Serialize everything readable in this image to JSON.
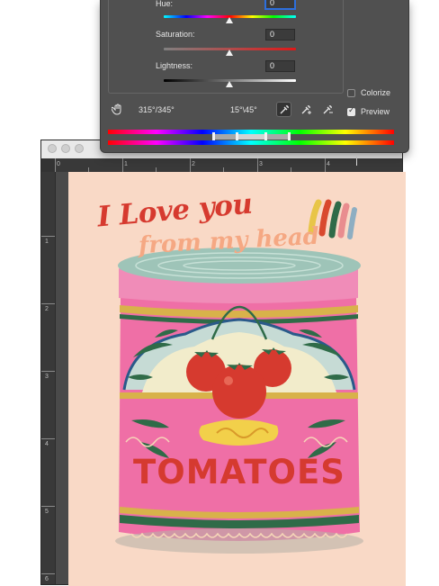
{
  "dialog": {
    "hue": {
      "label": "Hue:",
      "value": "0"
    },
    "saturation": {
      "label": "Saturation:",
      "value": "0"
    },
    "lightness": {
      "label": "Lightness:",
      "value": "0"
    },
    "range_left": "315°/345°",
    "range_right": "15°\\45°",
    "colorize_label": "Colorize",
    "colorize_checked": false,
    "preview_label": "Preview",
    "preview_checked": true
  },
  "rulers": {
    "top": [
      "0",
      "1",
      "2",
      "3",
      "4"
    ],
    "left": [
      "1",
      "2",
      "3",
      "4",
      "5",
      "6"
    ]
  },
  "artwork": {
    "headline": "I Love you",
    "subline": "from my head",
    "can_label": "TOMATOES"
  },
  "icons": {
    "hand": "hand-tool-icon",
    "eyedropper": "eyedropper-icon",
    "eyedropper_add": "eyedropper-plus-icon",
    "eyedropper_subtract": "eyedropper-minus-icon"
  },
  "colors": {
    "dialog_bg": "#505050",
    "accent": "#2d6fdc",
    "artboard": "#f9d9c6",
    "can_pink": "#ef6fa6",
    "lid": "#9ec4b8",
    "tomato_red": "#d53a30"
  }
}
